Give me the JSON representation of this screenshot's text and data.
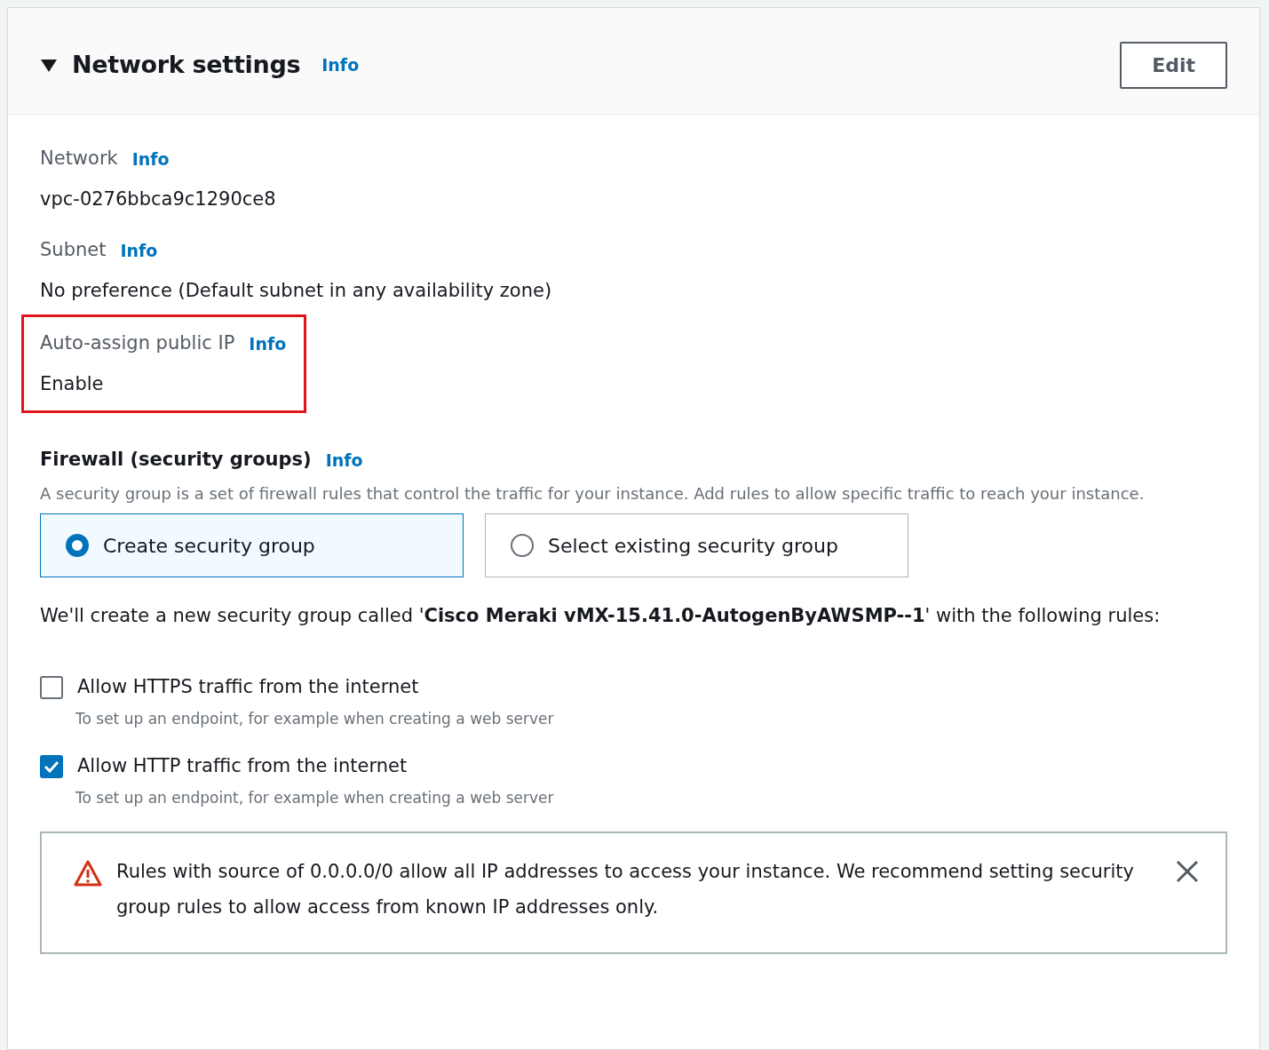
{
  "section": {
    "title": "Network settings",
    "info": "Info",
    "expanded": true,
    "edit_button": "Edit"
  },
  "fields": [
    {
      "label": "Network",
      "info": "Info",
      "value": "vpc-0276bbca9c1290ce8",
      "highlighted": false
    },
    {
      "label": "Subnet",
      "info": "Info",
      "value": "No preference (Default subnet in any availability zone)",
      "highlighted": false
    },
    {
      "label": "Auto-assign public IP",
      "info": "Info",
      "value": "Enable",
      "highlighted": true
    }
  ],
  "firewall": {
    "title": "Firewall (security groups)",
    "info": "Info",
    "description": "A security group is a set of firewall rules that control the traffic for your instance. Add rules to allow specific traffic to reach your instance.",
    "options": [
      {
        "label": "Create security group",
        "selected": true
      },
      {
        "label": "Select existing security group",
        "selected": false
      }
    ],
    "note": "We'll create a new security group called '**Cisco Meraki vMX-15.41.0-AutogenByAWSMP--1**' with the following rules:",
    "rules": [
      {
        "label": "Allow HTTPS traffic from the internet",
        "hint": "To set up an endpoint, for example when creating a web server",
        "checked": false
      },
      {
        "label": "Allow HTTP traffic from the internet",
        "hint": "To set up an endpoint, for example when creating a web server",
        "checked": true
      }
    ],
    "alert": {
      "kind": "warning",
      "message": "Rules with source of 0.0.0.0/0 allow all IP addresses to access your instance. We recommend setting security group rules to allow access from known IP addresses only.",
      "dismissible": true
    }
  }
}
